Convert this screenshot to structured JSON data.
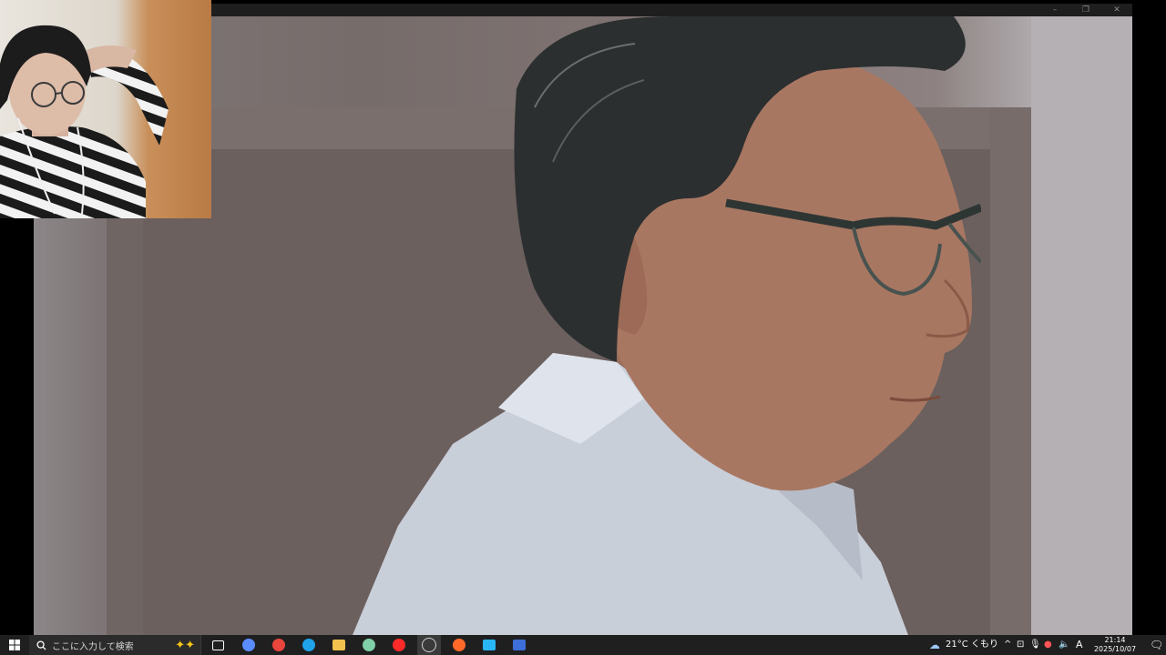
{
  "window": {
    "controls": {
      "minimize": "–",
      "maximize": "❐",
      "close": "✕"
    }
  },
  "taskbar": {
    "search_placeholder": "ここに入力して検索",
    "apps": [
      {
        "name": "copilot",
        "color": "#f5c518"
      },
      {
        "name": "task-view",
        "color": "#ffffff"
      },
      {
        "name": "copilot-app",
        "color": "#5b8cff"
      },
      {
        "name": "chrome",
        "color": "#e8453c"
      },
      {
        "name": "edge",
        "color": "#1fa2e8"
      },
      {
        "name": "file-explorer",
        "color": "#f2c14e"
      },
      {
        "name": "ai-app",
        "color": "#7fd0a8"
      },
      {
        "name": "youtube-music",
        "color": "#ff2a2a"
      },
      {
        "name": "obs-studio",
        "color": "#3a3a3a"
      },
      {
        "name": "recorder",
        "color": "#ff6a2b"
      },
      {
        "name": "capcut",
        "color": "#29b6f6"
      },
      {
        "name": "game-launcher",
        "color": "#3d6ed9"
      }
    ],
    "weather": {
      "temperature": "21°C",
      "condition": "くもり"
    },
    "ime": "A",
    "clock": {
      "time": "21:14",
      "date": "2025/10/07"
    }
  }
}
